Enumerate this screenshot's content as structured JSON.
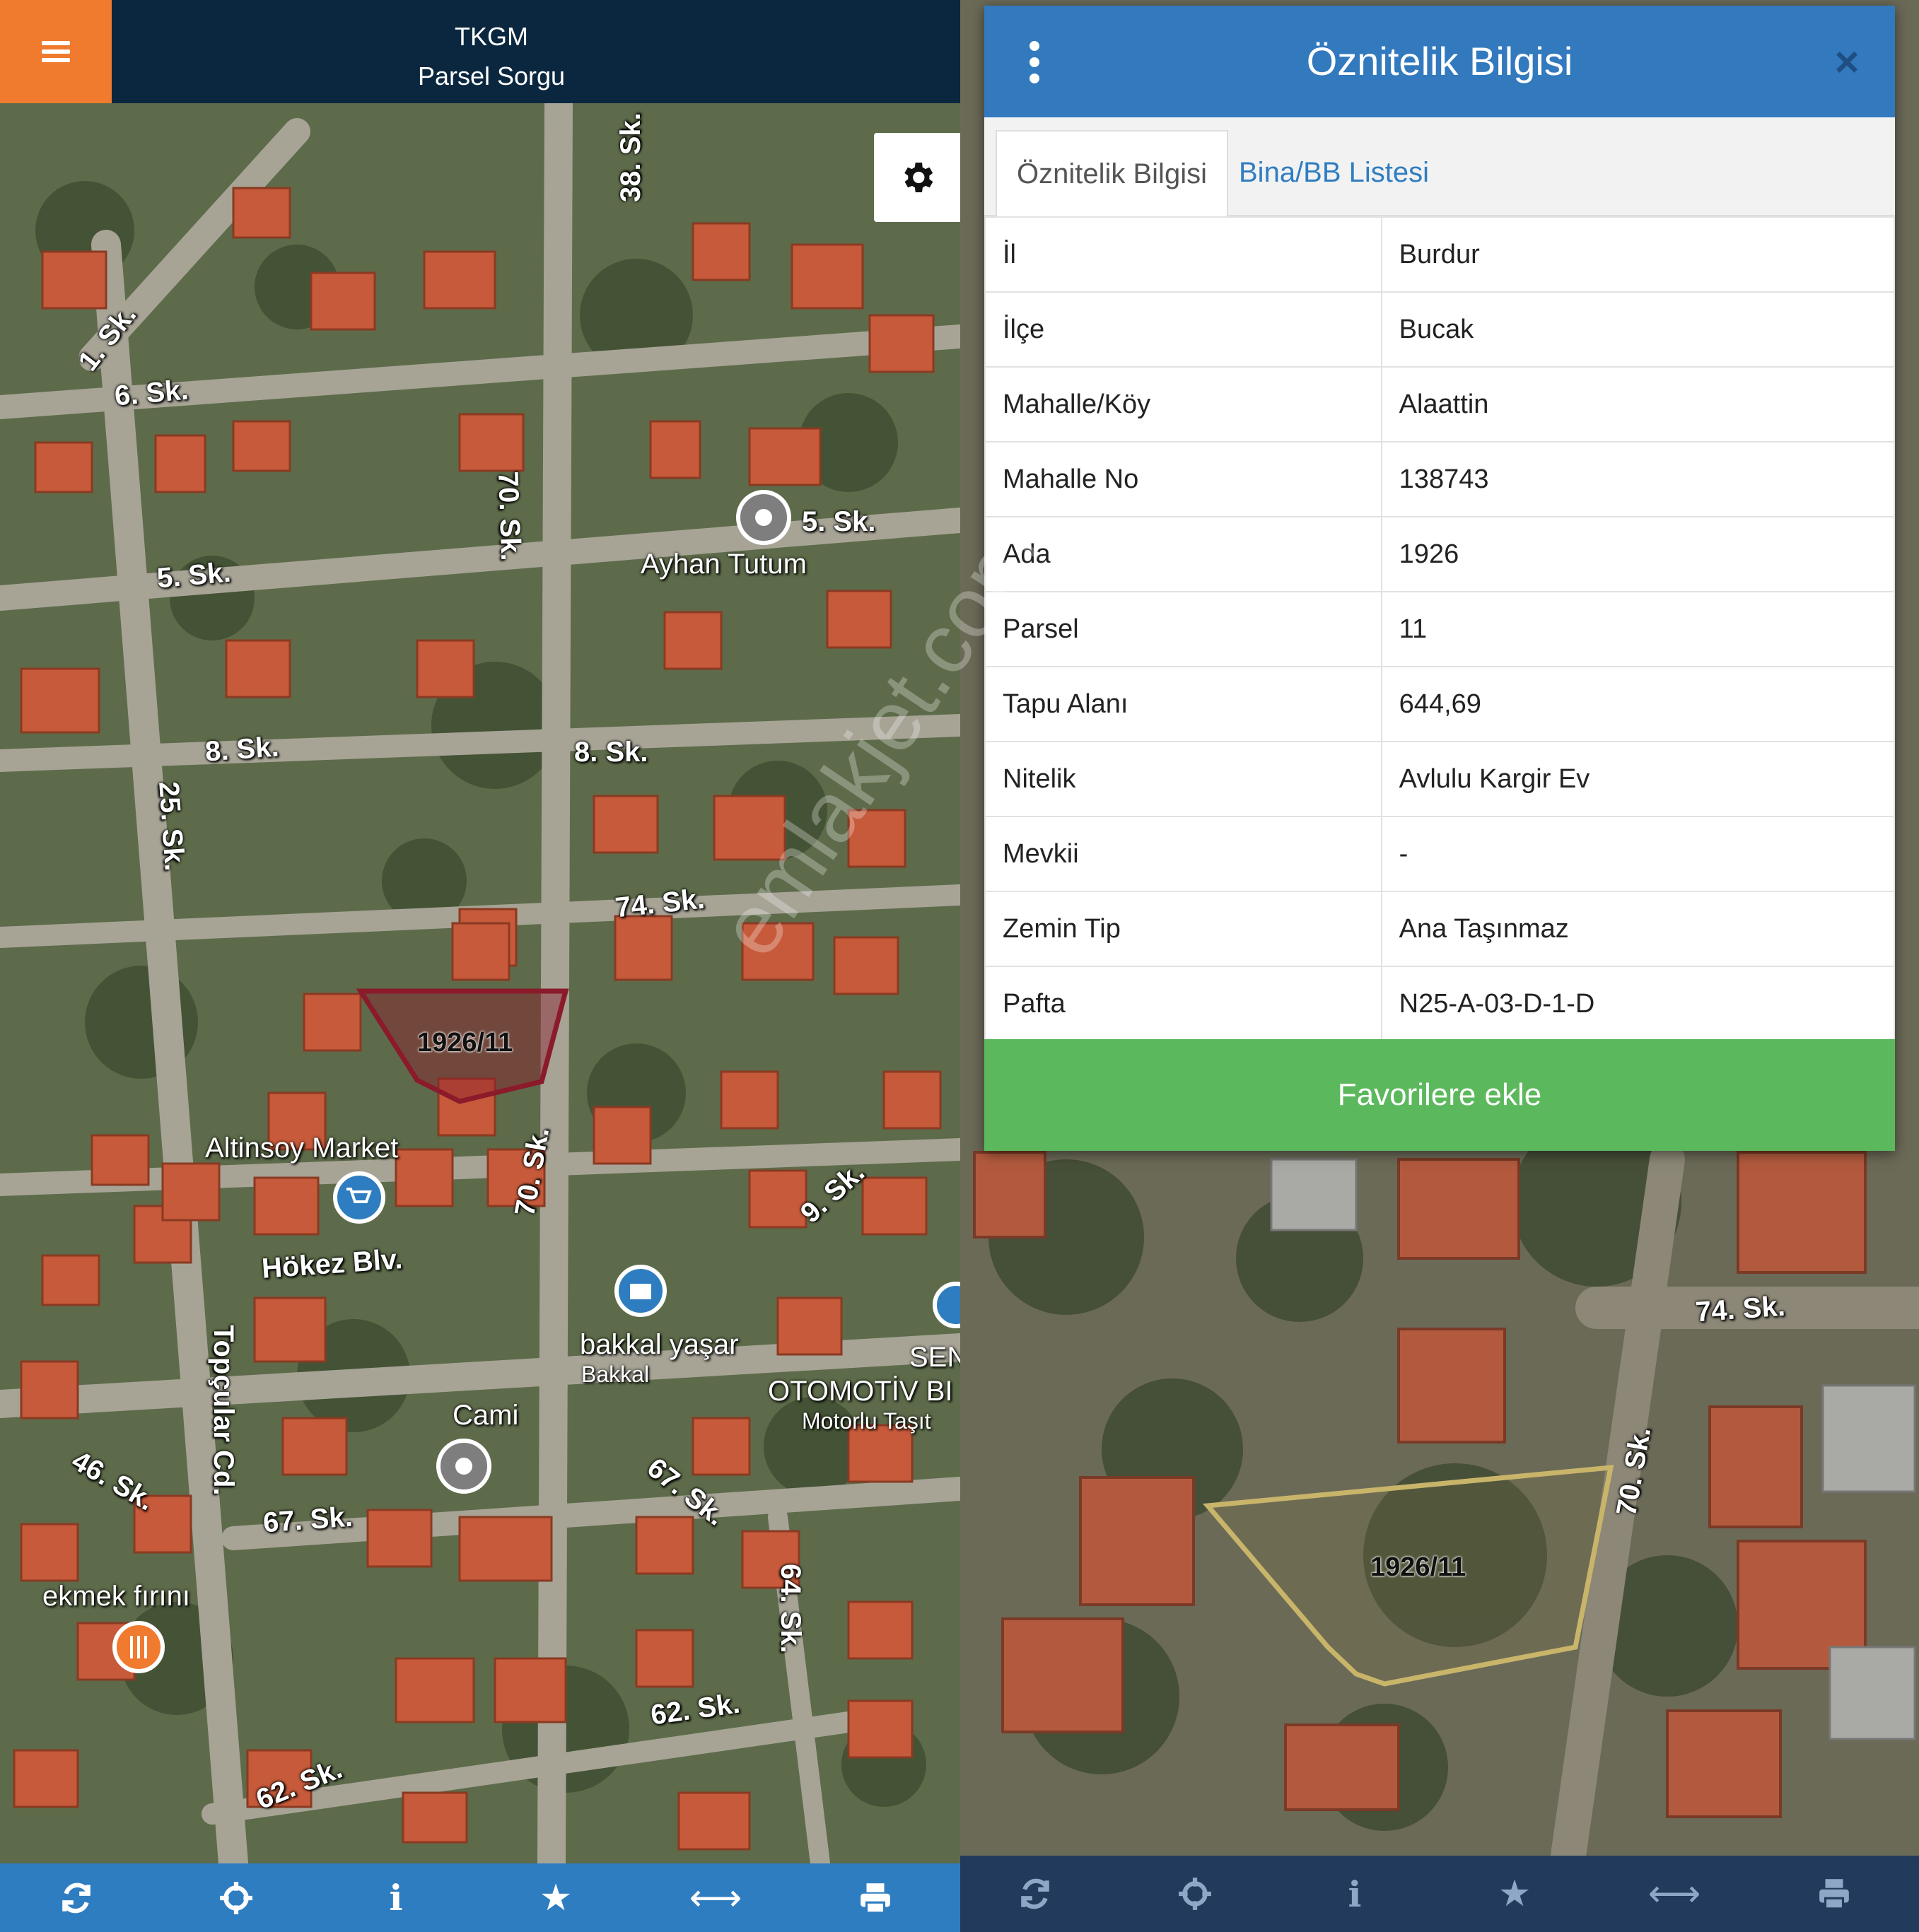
{
  "left": {
    "header": {
      "line1": "TKGM",
      "line2": "Parsel Sorgu"
    },
    "menu_icon": "hamburger-icon",
    "settings_icon": "gear-icon",
    "streets": [
      "1. Sk.",
      "6. Sk.",
      "70. Sk.",
      "38. Sk.",
      "5. Sk.",
      "5. Sk.",
      "8. Sk.",
      "8. Sk.",
      "25. Sk.",
      "74. Sk.",
      "70. Sk.",
      "9. Sk.",
      "Hökez Blv.",
      "Topçular Cd.",
      "46. Sk.",
      "67. Sk.",
      "67. Sk.",
      "64. Sk.",
      "62. Sk.",
      "62. Sk."
    ],
    "pois": {
      "ayhan": "Ayhan Tutum",
      "altinsoy": "Altinsoy Market",
      "bakkal_name": "bakkal yaşar",
      "bakkal_type": "Bakkal",
      "cami": "Cami",
      "ekmek": "ekmek fırını",
      "sen": "SEN",
      "otomotiv": "OTOMOTİV BI",
      "motorlu": "Motorlu Taşıt"
    },
    "parcel_label": "1926/11",
    "toolbar_icons": [
      "refresh-icon",
      "crosshair-icon",
      "info-icon",
      "star-icon",
      "measure-icon",
      "print-icon"
    ]
  },
  "right": {
    "modal": {
      "title": "Öznitelik Bilgisi",
      "close": "×",
      "tabs": [
        "Öznitelik Bilgisi",
        "Bina/BB Listesi"
      ],
      "rows": [
        {
          "key": "İl",
          "value": "Burdur"
        },
        {
          "key": "İlçe",
          "value": "Bucak"
        },
        {
          "key": "Mahalle/Köy",
          "value": "Alaattin"
        },
        {
          "key": "Mahalle No",
          "value": "138743"
        },
        {
          "key": "Ada",
          "value": "1926"
        },
        {
          "key": "Parsel",
          "value": "11"
        },
        {
          "key": "Tapu Alanı",
          "value": "644,69"
        },
        {
          "key": "Nitelik",
          "value": "Avlulu Kargir Ev"
        },
        {
          "key": "Mevkii",
          "value": "-"
        },
        {
          "key": "Zemin Tip",
          "value": "Ana Taşınmaz"
        },
        {
          "key": "Pafta",
          "value": "N25-A-03-D-1-D"
        }
      ],
      "favorite_button": "Favorilere ekle"
    },
    "streets": [
      "74. Sk.",
      "70. Sk."
    ],
    "parcel_label": "1926/11",
    "watermark": "emlakjet.com",
    "toolbar_icons": [
      "refresh-icon",
      "crosshair-icon",
      "info-icon",
      "star-icon",
      "measure-icon",
      "print-icon"
    ]
  },
  "colors": {
    "header_dark": "#0b2740",
    "menu_orange": "#f07a2e",
    "modal_blue": "#3279be",
    "toolbar_blue": "#2f7dc1",
    "favorite_green": "#5cb85c",
    "parcel_outline_left": "#8b1a2b",
    "parcel_outline_right": "#c9b56a"
  }
}
